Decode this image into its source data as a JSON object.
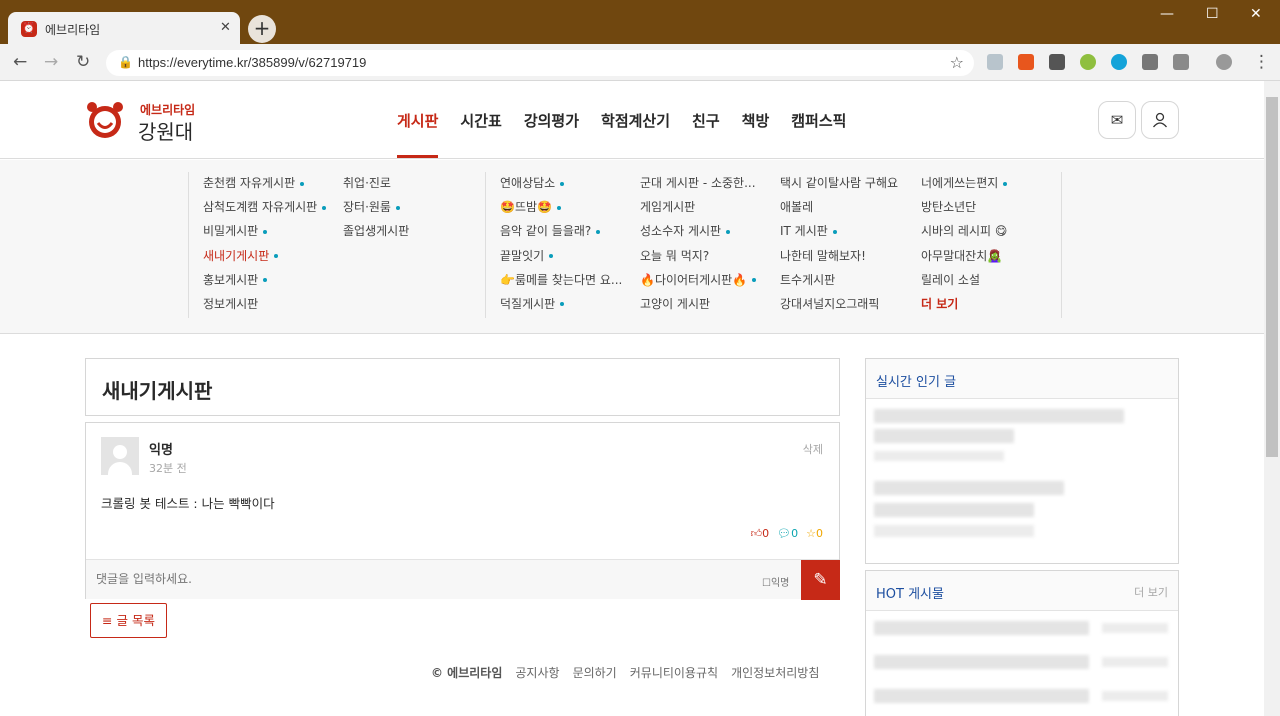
{
  "browser": {
    "tab_title": "에브리타임",
    "url": "https://everytime.kr/385899/v/62719719"
  },
  "site": {
    "logo_small": "에브리타임",
    "logo_big": "강원대",
    "nav": [
      "게시판",
      "시간표",
      "강의평가",
      "학점계산기",
      "친구",
      "책방",
      "캠퍼스픽"
    ],
    "active_nav": "게시판"
  },
  "submenu": {
    "columns": [
      [
        {
          "label": "춘천캠 자유게시판",
          "dot": true
        },
        {
          "label": "삼척도계캠 자유게시판",
          "dot": true
        },
        {
          "label": "비밀게시판",
          "dot": true
        },
        {
          "label": "새내기게시판",
          "dot": true,
          "active": true
        },
        {
          "label": "홍보게시판",
          "dot": true
        },
        {
          "label": "정보게시판",
          "dot": false
        }
      ],
      [
        {
          "label": "취업·진로",
          "dot": false
        },
        {
          "label": "장터·원룸",
          "dot": true
        },
        {
          "label": "졸업생게시판",
          "dot": false
        }
      ],
      [
        {
          "label": "연애상담소",
          "dot": true
        },
        {
          "label": "🤩뜨밤🤩",
          "dot": true
        },
        {
          "label": "음악 같이 들을래?",
          "dot": true
        },
        {
          "label": "끝말잇기",
          "dot": true
        },
        {
          "label": "👉룸메를 찾는다면 요...",
          "dot": false
        },
        {
          "label": "덕질게시판",
          "dot": true
        }
      ],
      [
        {
          "label": "군대 게시판 - 소중한...",
          "dot": false
        },
        {
          "label": "게임게시판",
          "dot": false
        },
        {
          "label": "성소수자 게시판",
          "dot": true
        },
        {
          "label": "오늘 뭐 먹지?",
          "dot": false
        },
        {
          "label": "🔥다이어터게시판🔥",
          "dot": true
        },
        {
          "label": "고양이 게시판",
          "dot": false
        }
      ],
      [
        {
          "label": "택시 같이탈사람 구해요",
          "dot": false
        },
        {
          "label": "애볼레",
          "dot": false
        },
        {
          "label": "IT 게시판",
          "dot": true
        },
        {
          "label": "나한테 말해보자!",
          "dot": false
        },
        {
          "label": "트수게시판",
          "dot": false
        },
        {
          "label": "강대셔널지오그래픽",
          "dot": false
        }
      ],
      [
        {
          "label": "너에게쓰는편지",
          "dot": true
        },
        {
          "label": "방탄소년단",
          "dot": false
        },
        {
          "label": "시바의 레시피 😋",
          "dot": false
        },
        {
          "label": "아무말대잔치🧟‍♀️",
          "dot": false
        },
        {
          "label": "릴레이 소설",
          "dot": false
        },
        {
          "label": "더 보기",
          "dot": false,
          "more": true
        }
      ]
    ]
  },
  "board": {
    "title": "새내기게시판"
  },
  "article": {
    "author": "익명",
    "time": "32분 전",
    "delete_label": "삭제",
    "text": "크롤링 봇 테스트 : 나는 빡빡이다",
    "likes": "0",
    "comments": "0",
    "scraps": "0"
  },
  "comment_form": {
    "placeholder": "댓글을 입력하세요.",
    "anon_label": "익명"
  },
  "list_button": "글 목록",
  "footer": [
    "© 에브리타임",
    "공지사항",
    "문의하기",
    "커뮤니티이용규칙",
    "개인정보처리방침"
  ],
  "sidebar": {
    "realtime_title": "실시간 인기 글",
    "hot_title": "HOT 게시물",
    "hot_more": "더 보기"
  },
  "colors": {
    "brand": "#c62917",
    "titlebar": "#70470f",
    "dot": "#0a9dbb",
    "side_title": "#1d4fa0"
  }
}
